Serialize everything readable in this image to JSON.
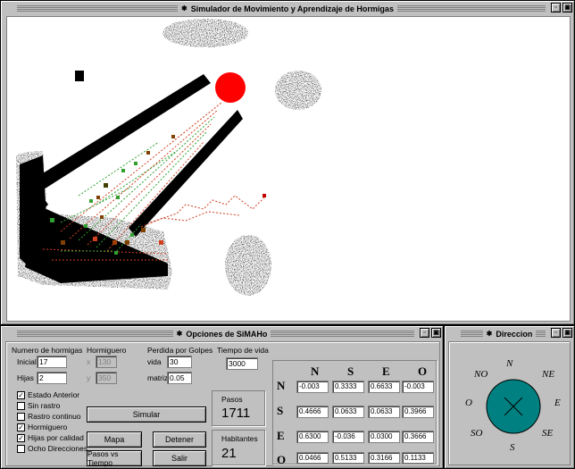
{
  "sim_window": {
    "title": "Simulador de Movimiento y Aprendizaje de Hormigas",
    "colors": {
      "nest": "#ff0000",
      "obstacle": "#000000",
      "trail_red": "#d04020",
      "trail_green": "#30a030",
      "ant": "#804000",
      "background": "#ffffff"
    }
  },
  "options_window": {
    "title": "Opciones de SiMAHo",
    "num_ants": {
      "heading": "Numero de hormigas",
      "initial_label": "Inicial",
      "initial_value": "17",
      "children_label": "Hijas",
      "children_value": "2"
    },
    "anthill": {
      "heading": "Hormiguero",
      "x_label": "x",
      "x_value": "130",
      "y_label": "y",
      "y_value": "350"
    },
    "hit_loss": {
      "heading": "Perdida por Golpes",
      "life_label": "vida",
      "life_value": "30",
      "matrix_label": "matriz",
      "matrix_value": "0.05"
    },
    "lifetime": {
      "heading": "Tiempo de vida",
      "value": "3000"
    },
    "checkboxes": [
      {
        "label": "Estado Anterior",
        "checked": true
      },
      {
        "label": "Sin rastro",
        "checked": false
      },
      {
        "label": "Rastro continuo",
        "checked": false
      },
      {
        "label": "Hormiguero",
        "checked": true
      },
      {
        "label": "Hijas por calidad",
        "checked": true
      },
      {
        "label": "Ocho Direcciones",
        "checked": false
      }
    ],
    "buttons": {
      "simulate": "Simular",
      "map": "Mapa",
      "stop": "Detener",
      "steps_vs_time": "Pasos vs Tiempo",
      "exit": "Salir"
    },
    "steps": {
      "label": "Pasos",
      "value": "1711"
    },
    "inhabitants": {
      "label": "Habitantes",
      "value": "21"
    },
    "matrix": {
      "columns": [
        "N",
        "S",
        "E",
        "O"
      ],
      "rows": [
        {
          "label": "N",
          "values": [
            "-0.003",
            "0.3333",
            "0.6633",
            "-0.003"
          ]
        },
        {
          "label": "S",
          "values": [
            "0.4666",
            "0.0633",
            "0.0633",
            "0.3966"
          ]
        },
        {
          "label": "E",
          "values": [
            "0.6300",
            "-0.036",
            "0.0300",
            "0.3666"
          ]
        },
        {
          "label": "O",
          "values": [
            "0.0466",
            "0.5133",
            "0.3166",
            "0.1133"
          ]
        }
      ]
    }
  },
  "direction_window": {
    "title": "Direccion",
    "labels": {
      "n": "N",
      "ne": "NE",
      "e": "E",
      "se": "SE",
      "s": "S",
      "so": "SO",
      "o": "O",
      "no": "NO"
    },
    "dial_color": "#008080"
  }
}
